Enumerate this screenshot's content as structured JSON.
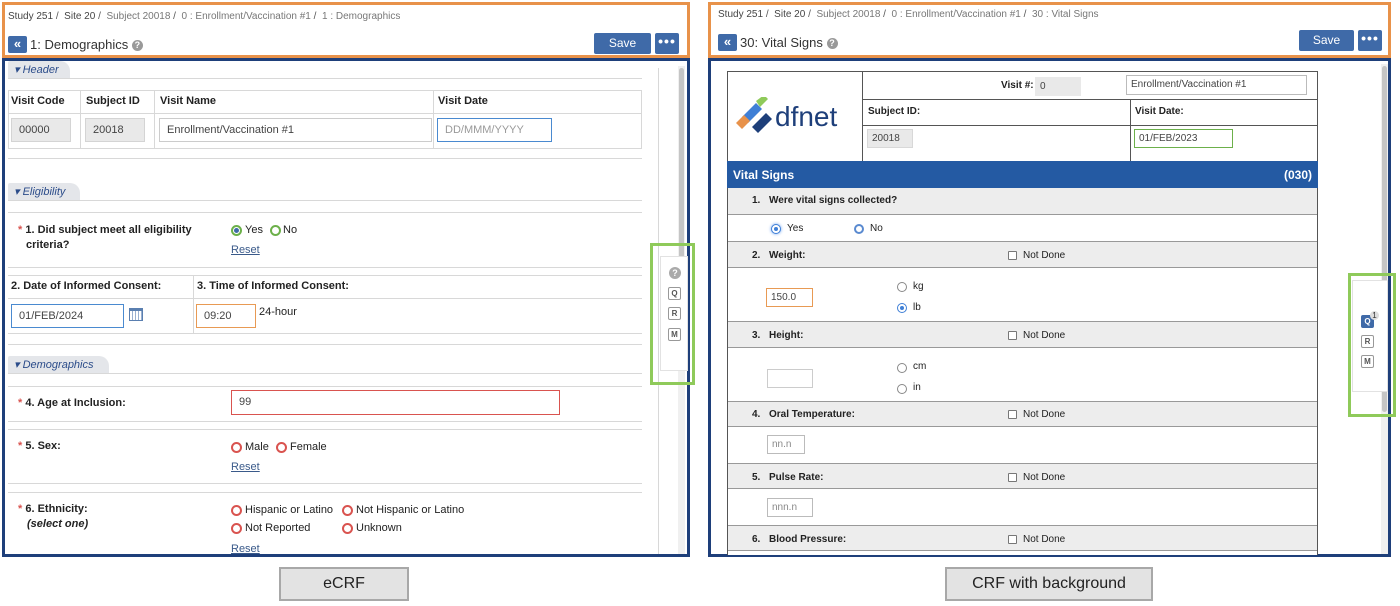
{
  "left": {
    "breadcrumb": [
      "Study 251",
      "Site 20",
      "Subject 20018",
      "0 : Enrollment/Vaccination #1",
      "1 : Demographics"
    ],
    "title": "1: Demographics",
    "save_label": "Save",
    "more_label": "•••",
    "back_label": "«",
    "sections": {
      "header": "Header",
      "eligibility": "Eligibility",
      "demographics": "Demographics"
    },
    "header_table": {
      "columns": [
        "Visit Code",
        "Subject ID",
        "Visit Name",
        "Visit Date"
      ],
      "visit_code": "00000",
      "subject_id": "20018",
      "visit_name": "Enrollment/Vaccination #1",
      "visit_date_placeholder": "DD/MMM/YYYY"
    },
    "q1": {
      "label_line1": "1. Did subject meet all eligibility",
      "label_line2": "criteria?",
      "options": [
        "Yes",
        "No"
      ],
      "selected": "Yes",
      "reset": "Reset"
    },
    "q2": {
      "label": "2. Date of Informed Consent:",
      "value": "01/FEB/2024"
    },
    "q3": {
      "label": "3. Time of Informed Consent:",
      "value": "09:20",
      "suffix": "24-hour"
    },
    "q4": {
      "label": "4. Age at Inclusion:",
      "value": "99"
    },
    "q5": {
      "label": "5. Sex:",
      "options": [
        "Male",
        "Female"
      ],
      "reset": "Reset"
    },
    "q6": {
      "label": "6. Ethnicity:",
      "sublabel": "(select one)",
      "options": [
        "Hispanic or Latino",
        "Not Hispanic or Latino",
        "Not Reported",
        "Unknown"
      ],
      "reset": "Reset"
    },
    "side_buttons": [
      "Q",
      "R",
      "M"
    ],
    "caption": "eCRF"
  },
  "right": {
    "breadcrumb": [
      "Study 251",
      "Site 20",
      "Subject 20018",
      "0 : Enrollment/Vaccination #1",
      "30 : Vital Signs"
    ],
    "title": "30: Vital Signs",
    "save_label": "Save",
    "more_label": "•••",
    "back_label": "«",
    "logo_text": "dfnet",
    "visit_no_label": "Visit #:",
    "visit_no_value": "0",
    "visit_name": "Enrollment/Vaccination #1",
    "subject_id_label": "Subject ID:",
    "subject_id_value": "20018",
    "visit_date_label": "Visit Date:",
    "visit_date_value": "01/FEB/2023",
    "form_title": "Vital Signs",
    "form_code": "(030)",
    "q1": {
      "num": "1.",
      "label": "Were vital signs collected?",
      "options": [
        "Yes",
        "No"
      ],
      "selected": "Yes"
    },
    "not_done": "Not Done",
    "q2": {
      "num": "2.",
      "label": "Weight:",
      "value": "150.0",
      "units": [
        "kg",
        "lb"
      ],
      "selected_unit": "lb"
    },
    "q3": {
      "num": "3.",
      "label": "Height:",
      "units": [
        "cm",
        "in"
      ]
    },
    "q4": {
      "num": "4.",
      "label": "Oral Temperature:",
      "placeholder": "nn.n"
    },
    "q5": {
      "num": "5.",
      "label": "Pulse Rate:",
      "placeholder": "nnn.n"
    },
    "q6": {
      "num": "6.",
      "label": "Blood Pressure:"
    },
    "side_buttons": [
      "Q",
      "R",
      "M"
    ],
    "q_badge": "1",
    "caption": "CRF with background"
  },
  "colors": {
    "orange_frame": "#e8924a",
    "blue_frame": "#1e3f7a",
    "green_frame": "#8fca5a",
    "button_blue": "#3f6aa8",
    "header_blue": "#245aa3"
  }
}
